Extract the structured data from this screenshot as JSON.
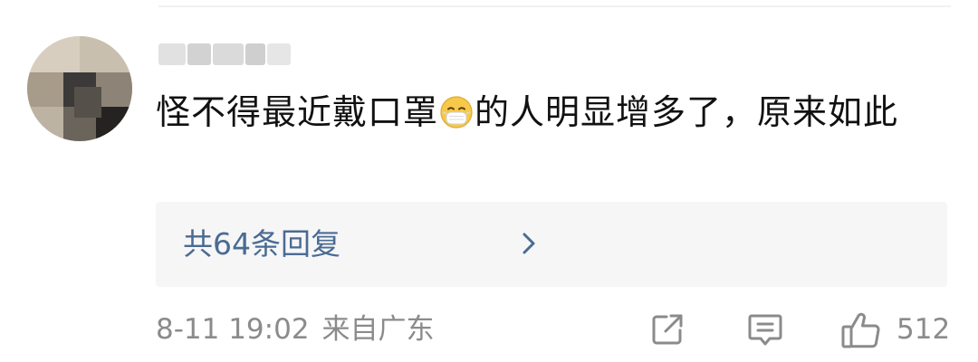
{
  "comment": {
    "text_before_emoji": "怪不得最近戴口罩",
    "emoji": "mask-face-emoji",
    "text_after_emoji": "的人明显增多了，原来如此"
  },
  "replies": {
    "label": "共64条回复",
    "chevron": "chevron-right-icon"
  },
  "meta": {
    "timestamp": "8-11 19:02",
    "location": "来自广东"
  },
  "actions": {
    "share_icon": "share-icon",
    "comment_icon": "comment-icon",
    "like_icon": "thumbs-up-icon",
    "like_count": "512"
  },
  "colors": {
    "reply_link": "#4a6b93",
    "meta_text": "#8b8b8b",
    "reply_background": "#f6f6f7"
  }
}
